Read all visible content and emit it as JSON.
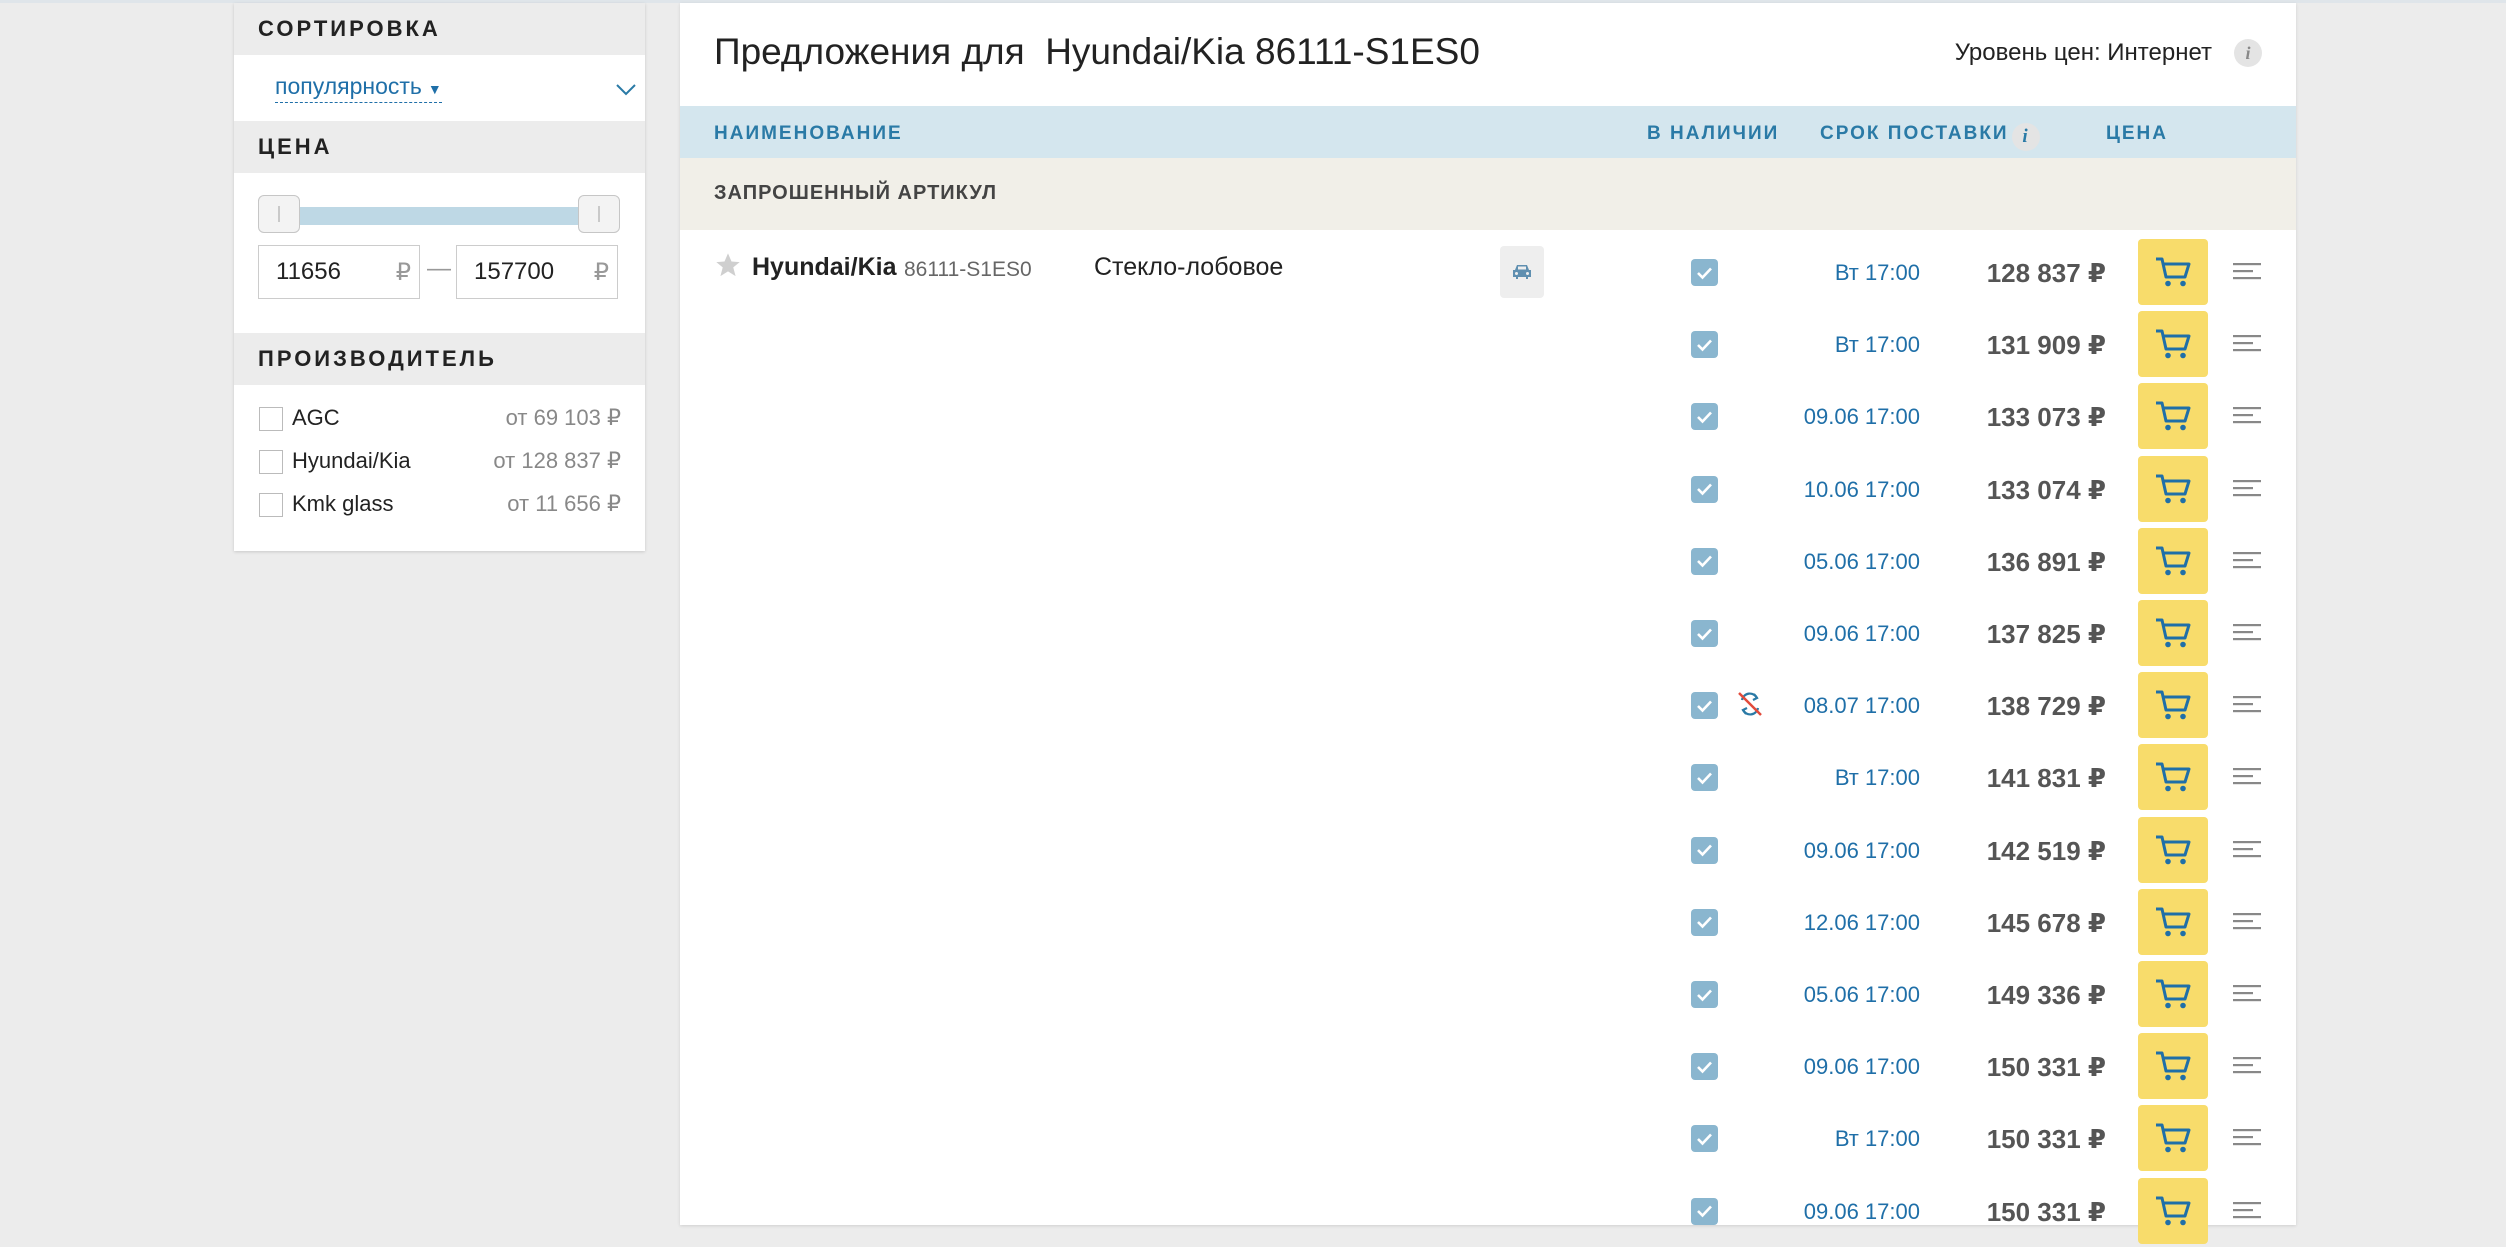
{
  "sidebar": {
    "sort": {
      "heading": "СОРТИРОВКА",
      "value": "популярность"
    },
    "price": {
      "heading": "ЦЕНА",
      "min": "11656",
      "max": "157700",
      "currency": "₽"
    },
    "manufacturer": {
      "heading": "ПРОИЗВОДИТЕЛЬ",
      "items": [
        {
          "name": "AGC",
          "from": "от 69 103 ₽"
        },
        {
          "name": "Hyundai/Kia",
          "from": "от 128 837 ₽"
        },
        {
          "name": "Kmk glass",
          "from": "от 11 656 ₽"
        }
      ]
    }
  },
  "header": {
    "title": "Предложения для  Hyundai/Kia 86111-S1ES0",
    "price_level": "Уровень цен: Интернет"
  },
  "columns": {
    "name": "НАИМЕНОВАНИЕ",
    "stock": "В НАЛИЧИИ",
    "delivery": "СРОК ПОСТАВКИ",
    "price": "ЦЕНА"
  },
  "section": {
    "requested": "ЗАПРОШЕННЫЙ АРТИКУЛ"
  },
  "product": {
    "brand": "Hyundai/Kia",
    "article": "86111-S1ES0",
    "description": "Стекло-лобовое"
  },
  "offers": [
    {
      "delivery": "Вт 17:00",
      "price": "128 837 ₽",
      "no_return": false
    },
    {
      "delivery": "Вт 17:00",
      "price": "131 909 ₽",
      "no_return": false
    },
    {
      "delivery": "09.06 17:00",
      "price": "133 073 ₽",
      "no_return": false
    },
    {
      "delivery": "10.06 17:00",
      "price": "133 074 ₽",
      "no_return": false
    },
    {
      "delivery": "05.06 17:00",
      "price": "136 891 ₽",
      "no_return": false
    },
    {
      "delivery": "09.06 17:00",
      "price": "137 825 ₽",
      "no_return": false
    },
    {
      "delivery": "08.07 17:00",
      "price": "138 729 ₽",
      "no_return": true
    },
    {
      "delivery": "Вт 17:00",
      "price": "141 831 ₽",
      "no_return": false
    },
    {
      "delivery": "09.06 17:00",
      "price": "142 519 ₽",
      "no_return": false
    },
    {
      "delivery": "12.06 17:00",
      "price": "145 678 ₽",
      "no_return": false
    },
    {
      "delivery": "05.06 17:00",
      "price": "149 336 ₽",
      "no_return": false
    },
    {
      "delivery": "09.06 17:00",
      "price": "150 331 ₽",
      "no_return": false
    },
    {
      "delivery": "Вт 17:00",
      "price": "150 331 ₽",
      "no_return": false
    },
    {
      "delivery": "09.06 17:00",
      "price": "150 331 ₽",
      "no_return": false
    }
  ]
}
